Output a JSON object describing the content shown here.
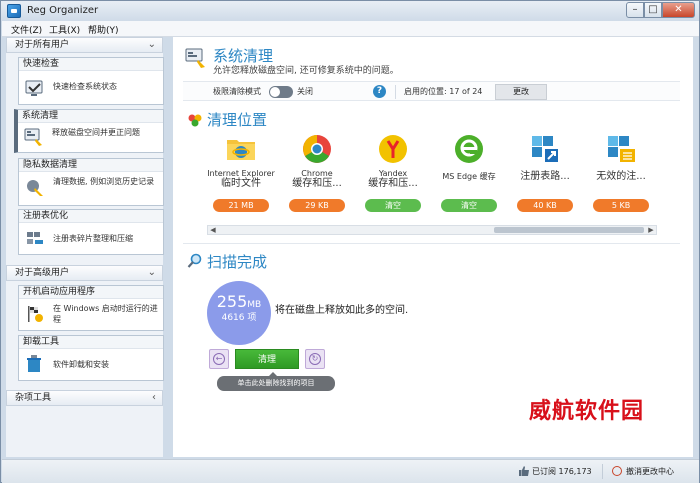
{
  "window": {
    "title": "Reg Organizer"
  },
  "menu": [
    {
      "label": "文件(Z)"
    },
    {
      "label": "工具(X)"
    },
    {
      "label": "帮助(Y)"
    }
  ],
  "sidebar": {
    "section_all_users": "对于所有用户",
    "section_advanced": "对于高级用户",
    "section_misc": "杂项工具",
    "groups": [
      {
        "title": "快速检查",
        "desc": "快速检查系统状态"
      },
      {
        "title": "系统清理",
        "desc": "释放磁盘空间并更正问题"
      },
      {
        "title": "隐私数据清理",
        "desc": "清理数据, 例如浏览历史记录"
      },
      {
        "title": "注册表优化",
        "desc": "注册表碎片整理和压缩"
      },
      {
        "title": "开机启动应用程序",
        "desc": "在 Windows 启动时运行的进程"
      },
      {
        "title": "卸载工具",
        "desc": "软件卸载和安装"
      }
    ]
  },
  "main": {
    "title": "系统清理",
    "subtitle": "允许您释放磁盘空间, 还可修复系统中的问题。",
    "toolbar": {
      "extreme_mode_label": "极限清除模式",
      "toggle_state_label": "关闭",
      "help_label": "?",
      "enabled_locations_label": "启用的位置: 17 of 24",
      "change_button": "更改"
    },
    "locations_title": "清理位置",
    "locations": [
      {
        "line1": "Internet Explorer",
        "line2": "临时文件",
        "badge": "21 MB",
        "badge_color": "#f07a2a"
      },
      {
        "line1": "Chrome",
        "line2": "缓存和压...",
        "badge": "29 KB",
        "badge_color": "#f07a2a"
      },
      {
        "line1": "Yandex",
        "line2": "缓存和压...",
        "badge": "清空",
        "badge_color": "#5cbc4e"
      },
      {
        "line1": "",
        "line2": "MS Edge 缓存",
        "badge": "清空",
        "badge_color": "#5cbc4e"
      },
      {
        "line1": "",
        "line2": "注册表路...",
        "badge": "40 KB",
        "badge_color": "#f07a2a"
      },
      {
        "line1": "",
        "line2": "无效的注...",
        "badge": "5 KB",
        "badge_color": "#f07a2a"
      }
    ],
    "scan_title": "扫描完成",
    "result": {
      "size": "255",
      "unit": "MB",
      "items": "4616 项",
      "text": "将在磁盘上释放如此多的空间."
    },
    "clean_button": "清理",
    "tooltip": "单击此处删除找到的项目"
  },
  "watermark": "威航软件园",
  "status": {
    "subscribed": "已订阅 176,173",
    "cancel_changes": "撤消更改中心"
  },
  "colors": {
    "accent_blue": "#2d87c4",
    "orange_badge": "#f07a2a",
    "green_badge": "#5cbc4e",
    "green_button": "#3aa82e",
    "result_circle": "#8b9bea",
    "watermark_red": "#d8101a"
  }
}
